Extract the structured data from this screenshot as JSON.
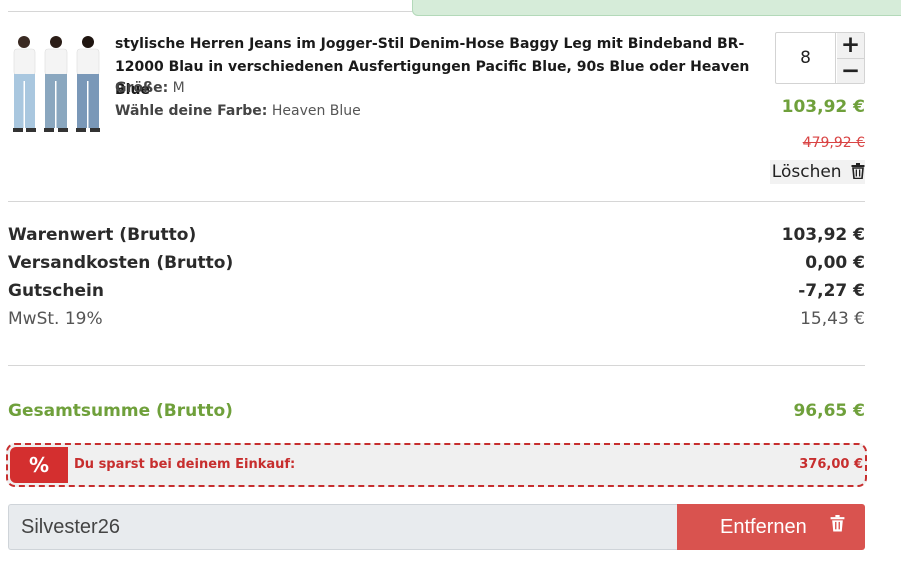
{
  "product": {
    "title": "stylische Herren Jeans im Jogger-Stil Denim-Hose Baggy Leg mit Bindeband BR-12000 Blau in verschiedenen Ausfertigungen Pacific Blue, 90s Blue oder Heaven Blue",
    "size_label": "Größe:",
    "size_value": "M",
    "color_label": "Wähle deine Farbe:",
    "color_value": "Heaven Blue",
    "quantity": "8",
    "plus_label": "+",
    "minus_label": "−",
    "price_current": "103,92 €",
    "price_old": "479,92 €",
    "delete_label": "Löschen"
  },
  "totals": {
    "rows": [
      {
        "label": "Warenwert (Brutto)",
        "value": "103,92 €"
      },
      {
        "label": "Versandkosten (Brutto)",
        "value": "0,00 €"
      },
      {
        "label": "Gutschein",
        "value": "-7,27 €"
      },
      {
        "label": "MwSt. 19%",
        "value": "15,43 €"
      }
    ],
    "grand_label": "Gesamtsumme (Brutto)",
    "grand_value": "96,65 €"
  },
  "savings": {
    "badge": "%",
    "label": "Du sparst bei deinem Einkauf:",
    "value": "376,00 €"
  },
  "coupon": {
    "code": "Silvester26",
    "remove_label": "Entfernen"
  },
  "colors": {
    "accent_green": "#6fa03b",
    "alert_red": "#d9534f",
    "savings_red": "#c72e2e"
  }
}
